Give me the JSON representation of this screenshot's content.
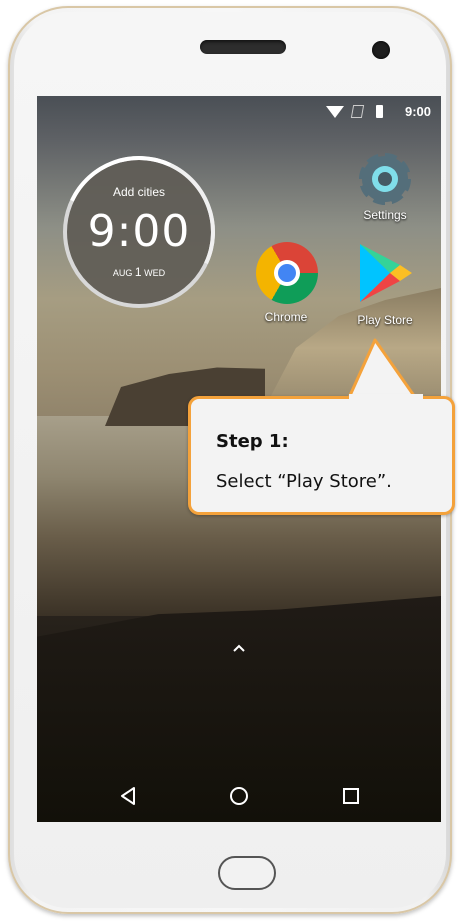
{
  "status_bar": {
    "time": "9:00",
    "icons": [
      "wifi-icon",
      "no-sim-icon",
      "battery-icon"
    ]
  },
  "clock_widget": {
    "cities_label": "Add cities",
    "time": "9:00",
    "date_month": "AUG",
    "date_day": "1",
    "date_weekday": "WED"
  },
  "apps": [
    {
      "name": "Settings",
      "icon": "gear-icon"
    },
    {
      "name": "Chrome",
      "icon": "chrome-icon"
    },
    {
      "name": "Play Store",
      "icon": "play-store-icon"
    }
  ],
  "callout": {
    "title": "Step 1:",
    "text": "Select “Play Store”."
  },
  "colors": {
    "callout_border": "#f4a23b",
    "callout_bg": "#f3f3f3"
  },
  "nav_bar": {
    "buttons": [
      "back-icon",
      "home-icon",
      "recents-icon"
    ]
  }
}
